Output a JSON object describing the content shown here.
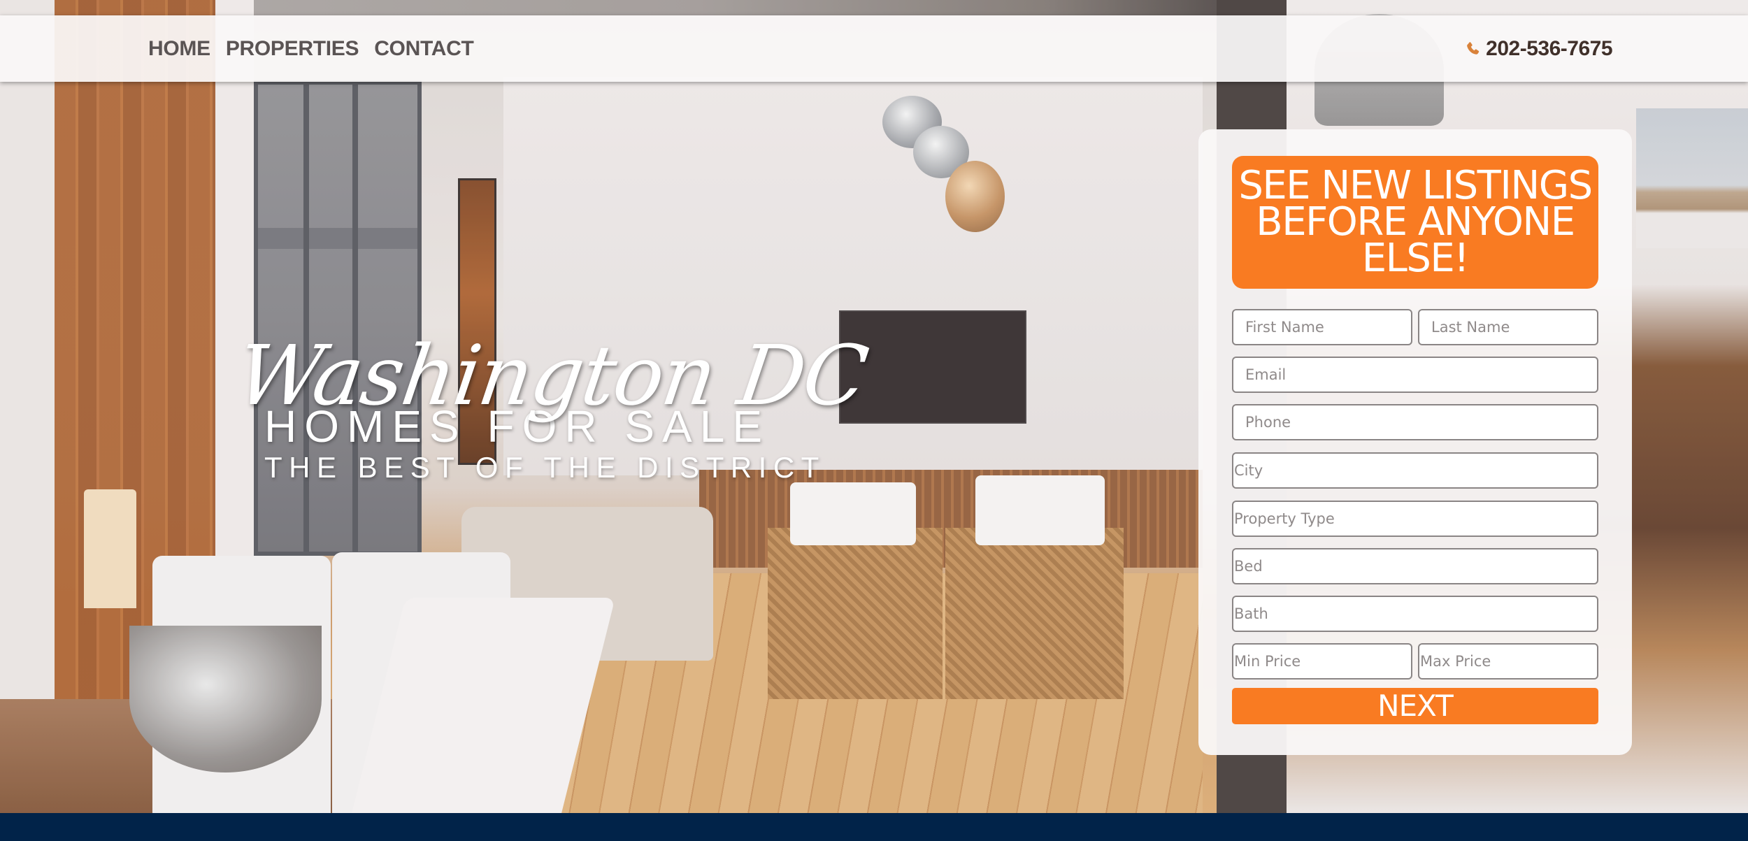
{
  "nav": {
    "links": [
      "HOME",
      "PROPERTIES",
      "CONTACT"
    ],
    "phone": {
      "icon": "phone-icon",
      "number": "202-536-7675",
      "icon_color": "#d9823a"
    }
  },
  "hero": {
    "script_title": "Washington DC",
    "title": "HOMES FOR SALE",
    "tagline": "THE BEST OF THE DISTRICT"
  },
  "lead_form": {
    "header": "SEE NEW LISTINGS BEFORE ANYONE ELSE!",
    "fields": {
      "first_name": {
        "placeholder": "First Name",
        "value": ""
      },
      "last_name": {
        "placeholder": "Last Name",
        "value": ""
      },
      "email": {
        "placeholder": "Email",
        "value": ""
      },
      "phone": {
        "placeholder": "Phone",
        "value": ""
      },
      "city": {
        "placeholder": "City",
        "value": ""
      },
      "property_type": {
        "placeholder": "Property Type",
        "value": ""
      },
      "bed": {
        "placeholder": "Bed",
        "value": ""
      },
      "bath": {
        "placeholder": "Bath",
        "value": ""
      },
      "min_price": {
        "placeholder": "Min Price",
        "value": ""
      },
      "max_price": {
        "placeholder": "Max Price",
        "value": ""
      }
    },
    "submit_label": "NEXT"
  },
  "colors": {
    "accent": "#f97b22",
    "footer": "#012349",
    "nav_text": "#5a5454",
    "phone_text": "#40302a"
  }
}
